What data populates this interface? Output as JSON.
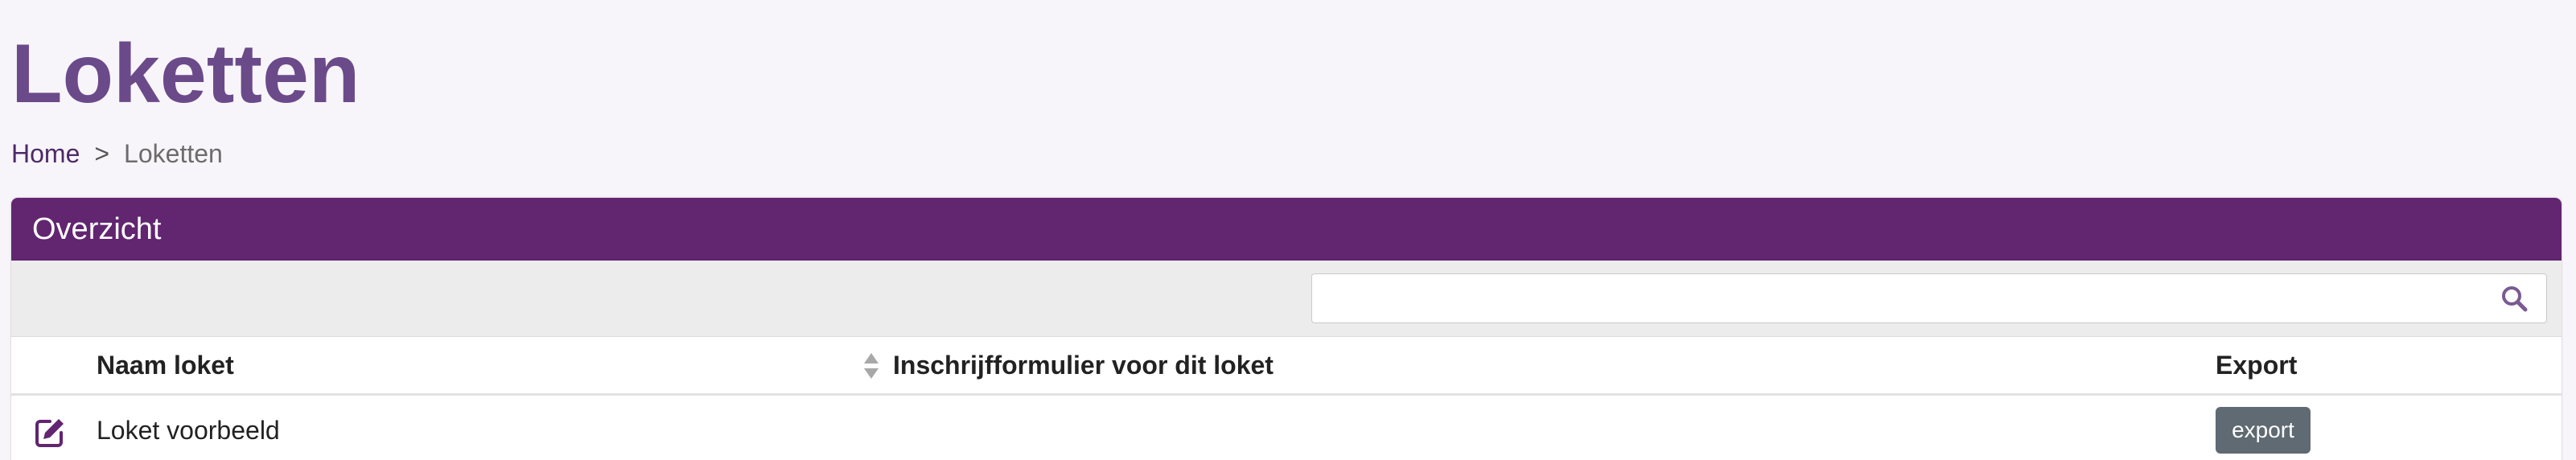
{
  "page": {
    "title": "Loketten"
  },
  "breadcrumb": {
    "home": "Home",
    "separator": ">",
    "current": "Loketten"
  },
  "card": {
    "header": "Overzicht"
  },
  "search": {
    "value": "",
    "placeholder": "",
    "icon": "search-icon"
  },
  "table": {
    "columns": [
      "Naam loket",
      "Inschrijfformulier voor dit loket",
      "Export"
    ],
    "rows": [
      {
        "icon": "edit-icon",
        "naam": "Loket voorbeeld",
        "formulier": "",
        "export_label": "export"
      }
    ]
  },
  "colors": {
    "title": "#6b4a8a",
    "header_bg": "#622570",
    "breadcrumb_link": "#4d2a66",
    "export_button": "#5f6a72",
    "search_icon": "#7a5a92",
    "edit_icon": "#622570"
  }
}
